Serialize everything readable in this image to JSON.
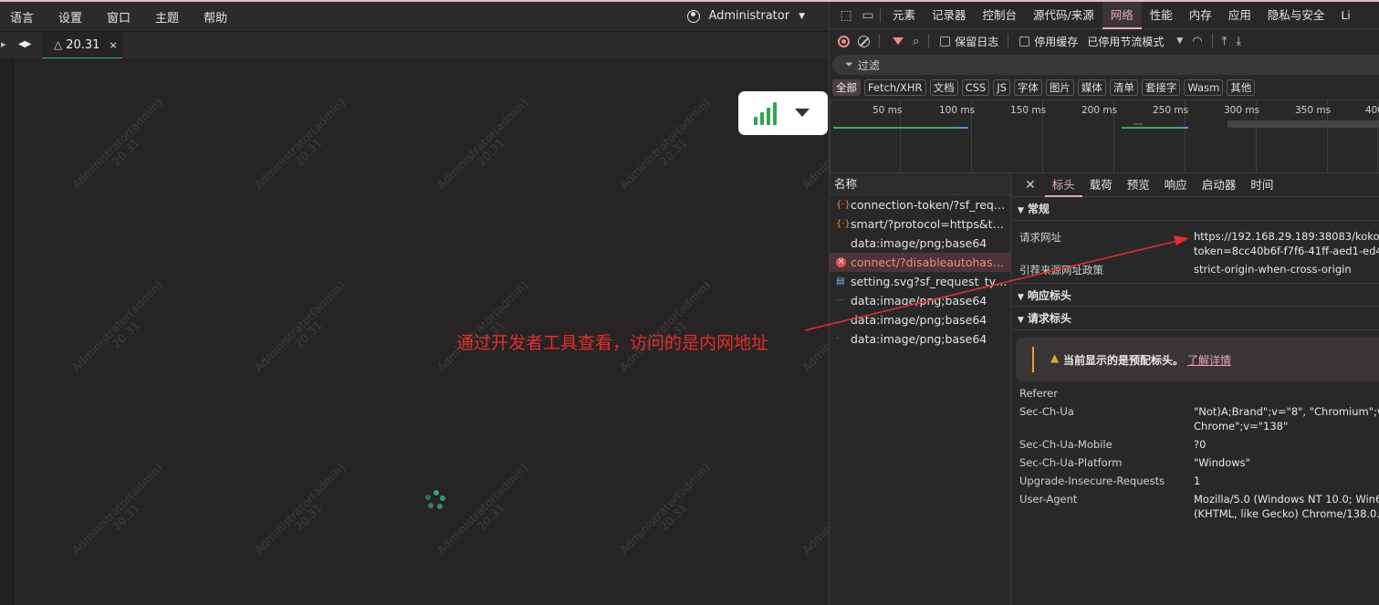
{
  "app": {
    "menu": [
      "语言",
      "设置",
      "窗口",
      "主题",
      "帮助"
    ],
    "user": "Administrator",
    "tab": {
      "title": "20.31",
      "close": "×"
    },
    "watermark": {
      "line1": "Administrator(admin)",
      "line2": "20.31"
    }
  },
  "annotation": "通过开发者工具查看，访问的是内网地址",
  "colors": {
    "accent": "#2fa88a",
    "devtools_active": "#e8a9c1",
    "annotation": "#e82b2b",
    "error": "#e4514a",
    "signal": "#2fa84a"
  },
  "devtools": {
    "tabs": [
      "元素",
      "记录器",
      "控制台",
      "源代码/来源",
      "网络",
      "性能",
      "内存",
      "应用",
      "隐私与安全",
      "Li"
    ],
    "active_tab": "网络",
    "toolbar": {
      "preserve_log": "保留日志",
      "disable_cache": "停用缓存",
      "throttle": "已停用节流模式"
    },
    "filter_placeholder": "过滤",
    "types": [
      "全部",
      "Fetch/XHR",
      "文档",
      "CSS",
      "JS",
      "字体",
      "图片",
      "媒体",
      "清单",
      "套接字",
      "Wasm",
      "其他"
    ],
    "timeline_ticks": [
      "50 ms",
      "100 ms",
      "150 ms",
      "200 ms",
      "250 ms",
      "300 ms",
      "350 ms",
      "400"
    ],
    "names_header": "名称",
    "requests": [
      {
        "icon": "{·}",
        "name": "connection-token/?sf_request_type=ajax"
      },
      {
        "icon": "{·}",
        "name": "smart/?protocol=https&token="
      },
      {
        "icon": "",
        "name": "data:image/png;base64"
      },
      {
        "icon": "×",
        "name": "connect/?disableautohash=1"
      },
      {
        "icon": "▤",
        "name": "setting.svg?sf_request_type=ajax"
      },
      {
        "icon": "···",
        "name": "data:image/png;base64"
      },
      {
        "icon": "",
        "name": "data:image/png;base64"
      },
      {
        "icon": "·",
        "name": "data:image/png;base64"
      }
    ],
    "detail_tabs": [
      "标头",
      "载荷",
      "预览",
      "响应",
      "启动器",
      "时间"
    ],
    "general": {
      "title": "常规",
      "request_url_label": "请求网址",
      "request_url_line1": "https://192.168.29.189:38083/koko/",
      "request_url_line2": "token=8cc40b6f-f7f6-41ff-aed1-ed4",
      "referrer_policy_label": "引荐来源网址政策",
      "referrer_policy": "strict-origin-when-cross-origin"
    },
    "response_headers_title": "响应标头",
    "request_headers_title": "请求标头",
    "warning": {
      "text": "当前显示的是预配标头。",
      "link": "了解详情"
    },
    "headers": [
      {
        "key": "Referer",
        "value": ""
      },
      {
        "key": "Sec-Ch-Ua",
        "value": "\"Not)A;Brand\";v=\"8\", \"Chromium\";v",
        "value2": "Chrome\";v=\"138\""
      },
      {
        "key": "Sec-Ch-Ua-Mobile",
        "value": "?0"
      },
      {
        "key": "Sec-Ch-Ua-Platform",
        "value": "\"Windows\""
      },
      {
        "key": "Upgrade-Insecure-Requests",
        "value": "1"
      },
      {
        "key": "User-Agent",
        "value": "Mozilla/5.0 (Windows NT 10.0; Win6",
        "value2": "(KHTML, like Gecko) Chrome/138.0."
      }
    ]
  }
}
